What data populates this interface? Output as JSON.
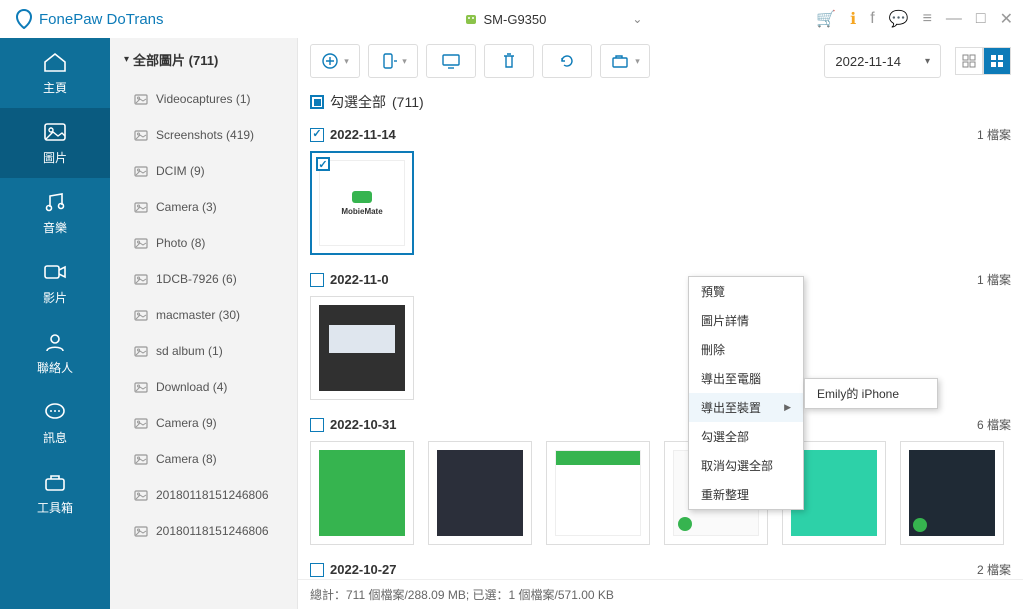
{
  "app_title": "FonePaw DoTrans",
  "device_name": "SM-G9350",
  "nav": [
    {
      "label": "主頁"
    },
    {
      "label": "圖片"
    },
    {
      "label": "音樂"
    },
    {
      "label": "影片"
    },
    {
      "label": "聯絡人"
    },
    {
      "label": "訊息"
    },
    {
      "label": "工具箱"
    }
  ],
  "folder_header_prefix": "全部圖片",
  "folder_header_count": "(711)",
  "folders": [
    {
      "name": "Videocaptures",
      "count": "(1)"
    },
    {
      "name": "Screenshots",
      "count": "(419)"
    },
    {
      "name": "DCIM",
      "count": "(9)"
    },
    {
      "name": "Camera",
      "count": "(3)"
    },
    {
      "name": "Photo",
      "count": "(8)"
    },
    {
      "name": "1DCB-7926",
      "count": "(6)"
    },
    {
      "name": "macmaster",
      "count": "(30)"
    },
    {
      "name": "sd album",
      "count": "(1)"
    },
    {
      "name": "Download",
      "count": "(4)"
    },
    {
      "name": "Camera",
      "count": "(9)"
    },
    {
      "name": "Camera",
      "count": "(8)"
    },
    {
      "name": "20180118151246806"
    },
    {
      "name": "20180118151246806"
    }
  ],
  "date_filter": "2022-11-14",
  "select_all_label": "勾選全部",
  "select_all_count": "(711)",
  "sections": [
    {
      "date": "2022-11-14",
      "count_label": "1 檔案",
      "checked": true,
      "thumbs": [
        {
          "kind": "mm",
          "selected": true
        }
      ]
    },
    {
      "date": "2022-11-0",
      "count_label": "1 檔案",
      "checked": false,
      "thumbs": [
        {
          "kind": "dark2"
        }
      ]
    },
    {
      "date": "2022-10-31",
      "count_label": "6 檔案",
      "checked": false,
      "thumbs": [
        {
          "kind": "green"
        },
        {
          "kind": "dark"
        },
        {
          "kind": "white"
        },
        {
          "kind": "white2"
        },
        {
          "kind": "graphic"
        },
        {
          "kind": "dark3"
        }
      ]
    },
    {
      "date": "2022-10-27",
      "count_label": "2 檔案",
      "checked": false,
      "thumbs": []
    }
  ],
  "thumb_mm_label": "MobieMate",
  "context_menu": {
    "items": [
      "預覽",
      "圖片詳情",
      "刪除",
      "導出至電腦",
      "導出至裝置",
      "勾選全部",
      "取消勾選全部",
      "重新整理"
    ],
    "submenu_trigger_index": 4,
    "submenu_item": "Emily的 iPhone"
  },
  "statusbar": "總計：711 個檔案/288.09 MB; 已選：1 個檔案/571.00 KB"
}
